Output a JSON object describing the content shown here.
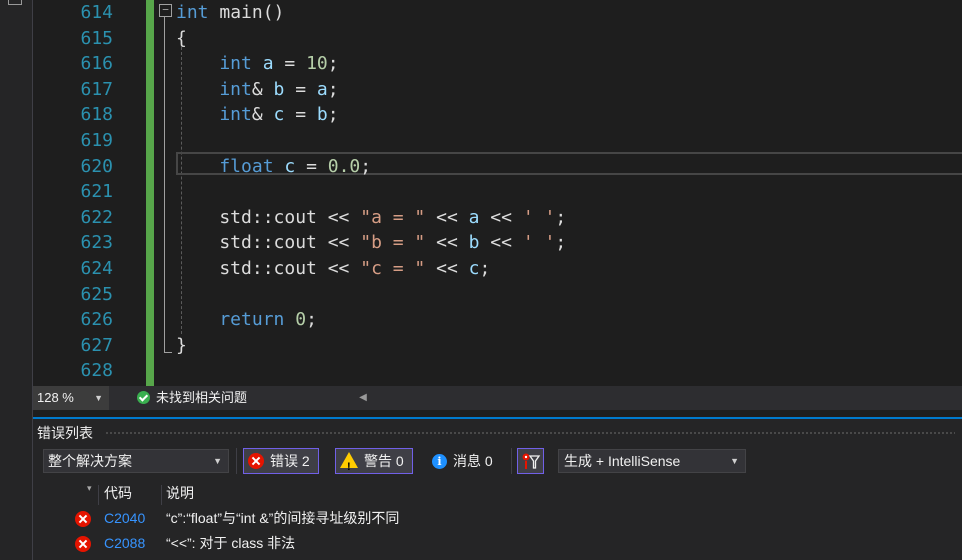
{
  "editor": {
    "lines": [
      {
        "no": "614",
        "tokens": [
          {
            "t": "int",
            "c": "kw"
          },
          {
            "t": " main()",
            "c": "plain"
          }
        ]
      },
      {
        "no": "615",
        "tokens": [
          {
            "t": "{",
            "c": "plain"
          }
        ]
      },
      {
        "no": "616",
        "tokens": [
          {
            "t": "    int",
            "c": "kw"
          },
          {
            "t": " ",
            "c": "plain"
          },
          {
            "t": "a",
            "c": "id"
          },
          {
            "t": " = ",
            "c": "plain"
          },
          {
            "t": "10",
            "c": "num"
          },
          {
            "t": ";",
            "c": "plain"
          }
        ]
      },
      {
        "no": "617",
        "tokens": [
          {
            "t": "    int",
            "c": "kw"
          },
          {
            "t": "& ",
            "c": "plain"
          },
          {
            "t": "b",
            "c": "id"
          },
          {
            "t": " = ",
            "c": "plain"
          },
          {
            "t": "a",
            "c": "id"
          },
          {
            "t": ";",
            "c": "plain"
          }
        ]
      },
      {
        "no": "618",
        "tokens": [
          {
            "t": "    int",
            "c": "kw"
          },
          {
            "t": "& ",
            "c": "plain"
          },
          {
            "t": "c",
            "c": "id"
          },
          {
            "t": " = ",
            "c": "plain"
          },
          {
            "t": "b",
            "c": "id"
          },
          {
            "t": ";",
            "c": "plain"
          }
        ]
      },
      {
        "no": "619",
        "tokens": []
      },
      {
        "no": "620",
        "tokens": [
          {
            "t": "    float",
            "c": "kw"
          },
          {
            "t": " ",
            "c": "plain"
          },
          {
            "t": "c",
            "c": "id"
          },
          {
            "t": " = ",
            "c": "plain"
          },
          {
            "t": "0.0",
            "c": "num"
          },
          {
            "t": ";",
            "c": "plain"
          }
        ]
      },
      {
        "no": "621",
        "tokens": []
      },
      {
        "no": "622",
        "tokens": [
          {
            "t": "    std::cout << ",
            "c": "plain"
          },
          {
            "t": "\"a = \"",
            "c": "str"
          },
          {
            "t": " << ",
            "c": "plain"
          },
          {
            "t": "a",
            "c": "id"
          },
          {
            "t": " << ",
            "c": "plain"
          },
          {
            "t": "' '",
            "c": "str"
          },
          {
            "t": ";",
            "c": "plain"
          }
        ]
      },
      {
        "no": "623",
        "tokens": [
          {
            "t": "    std::cout << ",
            "c": "plain"
          },
          {
            "t": "\"b = \"",
            "c": "str"
          },
          {
            "t": " << ",
            "c": "plain"
          },
          {
            "t": "b",
            "c": "id"
          },
          {
            "t": " << ",
            "c": "plain"
          },
          {
            "t": "' '",
            "c": "str"
          },
          {
            "t": ";",
            "c": "plain"
          }
        ]
      },
      {
        "no": "624",
        "tokens": [
          {
            "t": "    std::cout << ",
            "c": "plain"
          },
          {
            "t": "\"c = \"",
            "c": "str"
          },
          {
            "t": " << ",
            "c": "plain"
          },
          {
            "t": "c",
            "c": "id"
          },
          {
            "t": ";",
            "c": "plain"
          }
        ]
      },
      {
        "no": "625",
        "tokens": []
      },
      {
        "no": "626",
        "tokens": [
          {
            "t": "    return",
            "c": "kw"
          },
          {
            "t": " ",
            "c": "plain"
          },
          {
            "t": "0",
            "c": "num"
          },
          {
            "t": ";",
            "c": "plain"
          }
        ]
      },
      {
        "no": "627",
        "tokens": [
          {
            "t": "}",
            "c": "plain"
          }
        ]
      },
      {
        "no": "628",
        "tokens": []
      }
    ],
    "collapse_symbol": "−"
  },
  "statusbar": {
    "zoom": "128 %",
    "issues_text": "未找到相关问题"
  },
  "error_list": {
    "title": "错误列表",
    "scope": "整个解决方案",
    "errors_label": "错误 2",
    "warnings_label": "警告 0",
    "messages_label": "消息 0",
    "build_filter": "生成 + IntelliSense",
    "columns": {
      "code": "代码",
      "description": "说明"
    },
    "rows": [
      {
        "code": "C2040",
        "description": "“c”:“float”与“int &”的间接寻址级别不同"
      },
      {
        "code": "C2088",
        "description": "“<<”: 对于 class 非法"
      }
    ]
  },
  "colors": {
    "keyword": "#569cd6",
    "line_number": "#2b91af",
    "change_margin": "#57a64a",
    "error": "#e51400",
    "accent": "#007acc"
  }
}
